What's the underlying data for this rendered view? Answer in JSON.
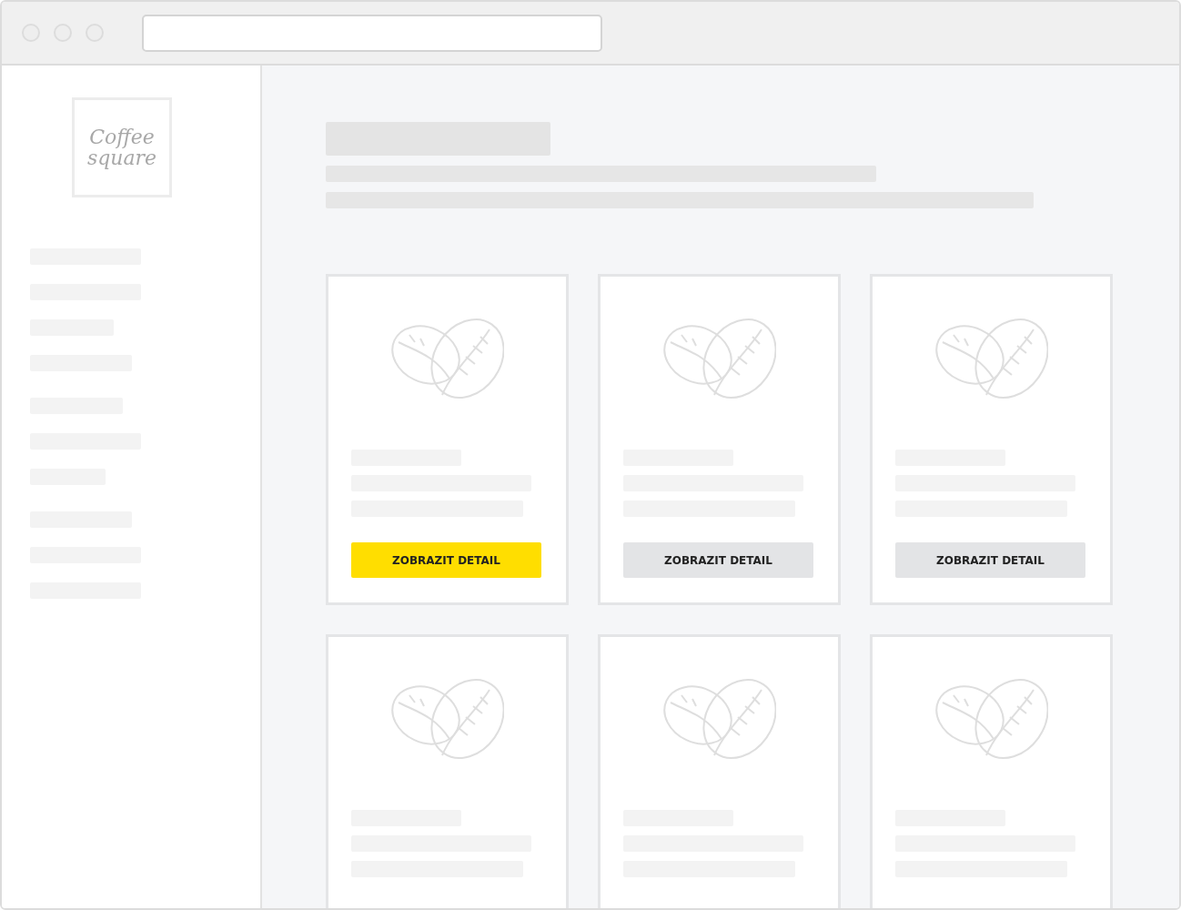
{
  "logo": {
    "lines": [
      "Coffee",
      "square"
    ]
  },
  "cards": [
    {
      "kind": "full",
      "button": {
        "label": "ZOBRAZIT DETAIL",
        "selected": true
      }
    },
    {
      "kind": "full",
      "button": {
        "label": "ZOBRAZIT DETAIL",
        "selected": false
      }
    },
    {
      "kind": "full",
      "button": {
        "label": "ZOBRAZIT DETAIL",
        "selected": false
      }
    },
    {
      "kind": "cropped"
    },
    {
      "kind": "cropped"
    },
    {
      "kind": "cropped"
    }
  ]
}
